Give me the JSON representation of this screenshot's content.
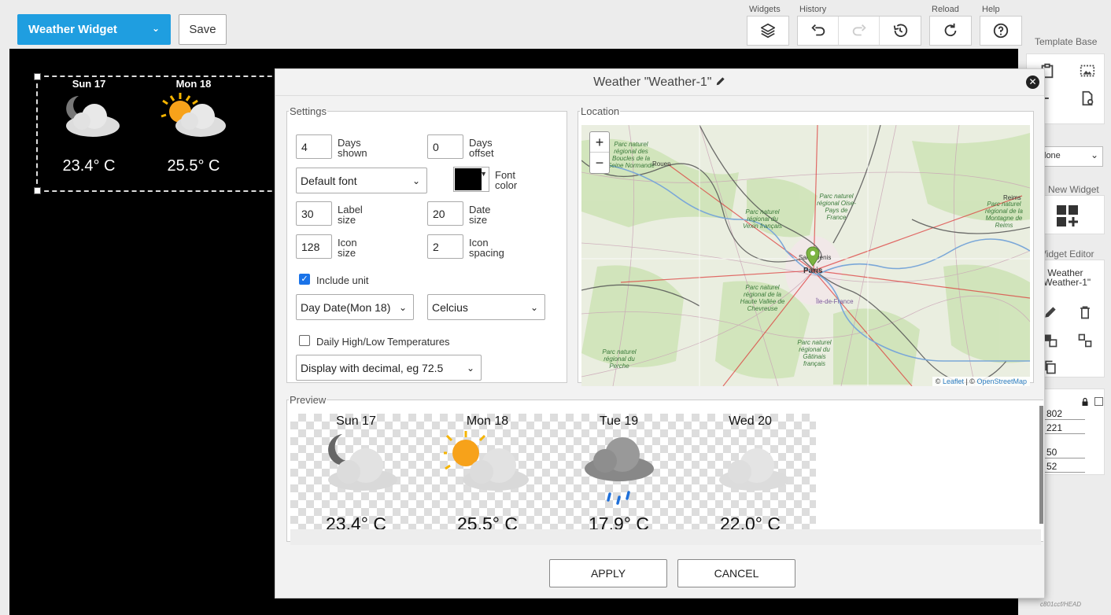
{
  "toolbar": {
    "widget_select": "Weather Widget",
    "save_label": "Save",
    "groups": {
      "widgets": "Widgets",
      "history": "History",
      "reload": "Reload",
      "help": "Help"
    }
  },
  "canvas_widget": {
    "days": [
      {
        "label": "Sun 17",
        "temp": "23.4° C",
        "icon": "night-cloud-icon"
      },
      {
        "label": "Mon 18",
        "temp": "25.5° C",
        "icon": "sun-cloud-icon"
      }
    ]
  },
  "right_panel": {
    "template_base": "Template Base",
    "select_value": "lone",
    "add_new_widget": "d New Widget",
    "widget_editor": "Vidget Editor",
    "widget_name_line1": "Weather",
    "widget_name_line2": "\"Weather-1\"",
    "width_value": "802",
    "height_value": "221",
    "x_value": "50",
    "y_value": "52",
    "version": "c801ccf/HEAD"
  },
  "modal": {
    "title": "Weather \"Weather-1\"",
    "settings": {
      "legend": "Settings",
      "days_shown_value": "4",
      "days_shown_label1": "Days",
      "days_shown_label2": "shown",
      "days_offset_value": "0",
      "days_offset_label1": "Days",
      "days_offset_label2": "offset",
      "font_select": "Default font",
      "font_color_label1": "Font",
      "font_color_label2": "color",
      "font_color": "#000000",
      "label_size_value": "30",
      "label_size_label1": "Label",
      "label_size_label2": "size",
      "date_size_value": "20",
      "date_size_label1": "Date",
      "date_size_label2": "size",
      "icon_size_value": "128",
      "icon_size_label1": "Icon",
      "icon_size_label2": "size",
      "icon_spacing_value": "2",
      "icon_spacing_label1": "Icon",
      "icon_spacing_label2": "spacing",
      "include_unit_label": "Include unit",
      "include_unit_checked": true,
      "date_format_select": "Day Date(Mon 18)",
      "unit_select": "Celcius",
      "high_low_label": "Daily High/Low Temperatures",
      "high_low_checked": false,
      "decimal_select": "Display with decimal, eg 72.5"
    },
    "location": {
      "legend": "Location",
      "zoom_in": "+",
      "zoom_out": "−",
      "attribution_prefix": "© ",
      "attribution_leaflet": "Leaflet",
      "attribution_sep": " | © ",
      "attribution_osm": "OpenStreetMap",
      "places": {
        "paris": "Paris",
        "rouen": "Rouen",
        "reims": "Reims",
        "saint_denis": "Saint-Denis",
        "ile_de_france": "Île-de-France"
      },
      "parks": {
        "boucles": "Parc naturel régional des Boucles de la Seine Normande",
        "vexin": "Parc naturel régional du Vexin français",
        "oise": "Parc naturel régional Oise-Pays de France",
        "montagne": "Parc naturel régional de la Montagne de Reims",
        "chevreuse": "Parc naturel régional de la Haute Vallée de Chevreuse",
        "perche": "Parc naturel régional du Perche",
        "gatinais": "Parc naturel régional du Gâtinais français"
      }
    },
    "preview": {
      "legend": "Preview",
      "days": [
        {
          "label": "Sun 17",
          "temp": "23.4° C",
          "icon": "night-cloud-icon"
        },
        {
          "label": "Mon 18",
          "temp": "25.5° C",
          "icon": "sun-cloud-icon"
        },
        {
          "label": "Tue 19",
          "temp": "17.9° C",
          "icon": "rain-cloud-icon"
        },
        {
          "label": "Wed 20",
          "temp": "22.0° C",
          "icon": "cloud-icon"
        }
      ]
    },
    "apply_label": "APPLY",
    "cancel_label": "CANCEL"
  }
}
